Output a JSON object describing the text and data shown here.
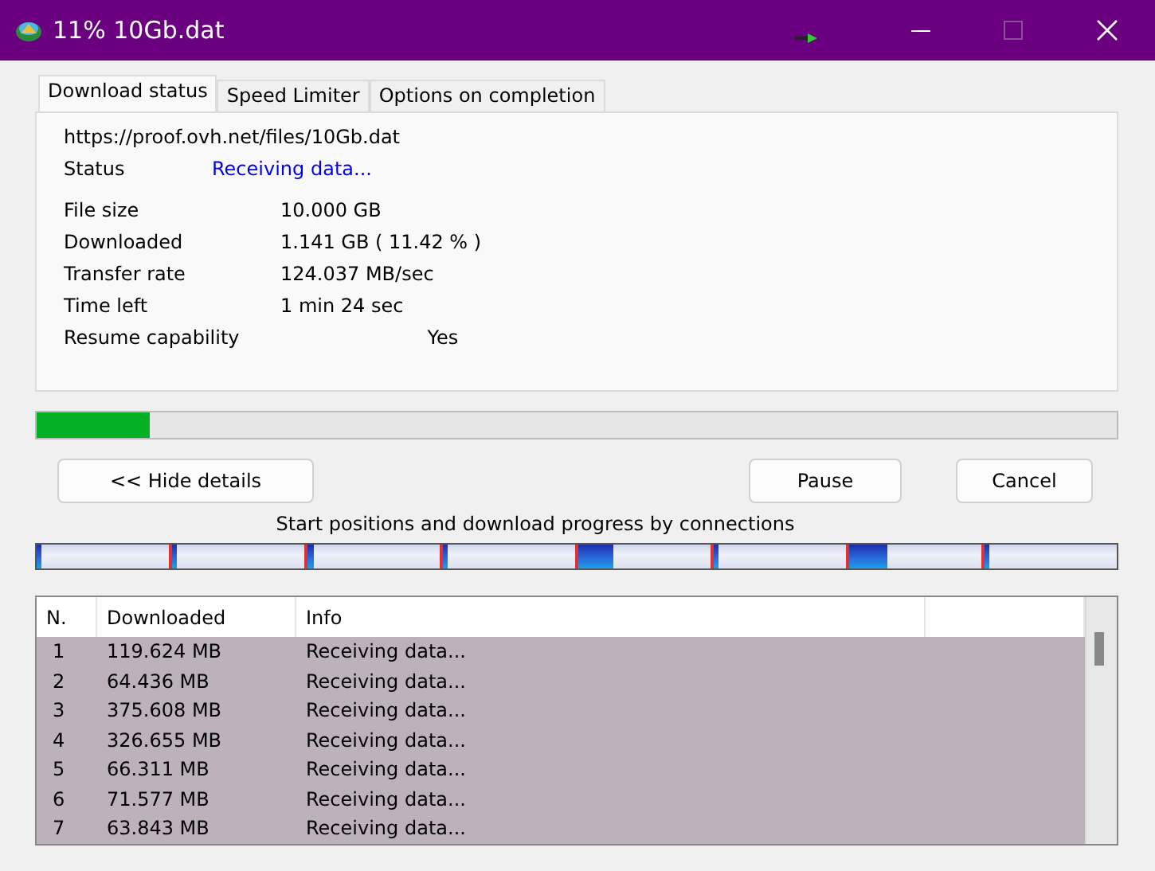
{
  "window": {
    "title": "11% 10Gb.dat",
    "maximize_disabled": true
  },
  "tabs": [
    {
      "label": "Download status",
      "selected": true
    },
    {
      "label": "Speed Limiter",
      "selected": false
    },
    {
      "label": "Options on completion",
      "selected": false
    }
  ],
  "url": "https://proof.ovh.net/files/10Gb.dat",
  "status": {
    "label": "Status",
    "value": "Receiving data..."
  },
  "details": [
    {
      "label": "File size",
      "value": "10.000  GB"
    },
    {
      "label": "Downloaded",
      "value": "1.141  GB  ( 11.42 % )"
    },
    {
      "label": "Transfer rate",
      "value": "124.037  MB/sec"
    },
    {
      "label": "Time left",
      "value": "1 min 24 sec"
    },
    {
      "label": "Resume capability",
      "value": "Yes",
      "kind": "far"
    }
  ],
  "progress": {
    "level": 0.105
  },
  "buttons": {
    "details": "<< Hide details",
    "pause": "Pause",
    "cancel": "Cancel"
  },
  "connections_caption": "Start positions and download progress by connections",
  "connection_segments": [
    {
      "level": 0.04
    },
    {
      "level": 0.04
    },
    {
      "level": 0.05
    },
    {
      "level": 0.04
    },
    {
      "level": 0.27
    },
    {
      "level": 0.03
    },
    {
      "level": 0.29
    },
    {
      "level": 0.03
    }
  ],
  "table": {
    "columns": [
      "N.",
      "Downloaded",
      "Info"
    ],
    "rows": [
      {
        "n": "1",
        "downloaded": "119.624  MB",
        "info": "Receiving data..."
      },
      {
        "n": "2",
        "downloaded": "64.436  MB",
        "info": "Receiving data..."
      },
      {
        "n": "3",
        "downloaded": "375.608  MB",
        "info": "Receiving data..."
      },
      {
        "n": "4",
        "downloaded": "326.655  MB",
        "info": "Receiving data..."
      },
      {
        "n": "5",
        "downloaded": "66.311  MB",
        "info": "Receiving data..."
      },
      {
        "n": "6",
        "downloaded": "71.577  MB",
        "info": "Receiving data..."
      },
      {
        "n": "7",
        "downloaded": "63.843  MB",
        "info": "Receiving data..."
      }
    ]
  }
}
